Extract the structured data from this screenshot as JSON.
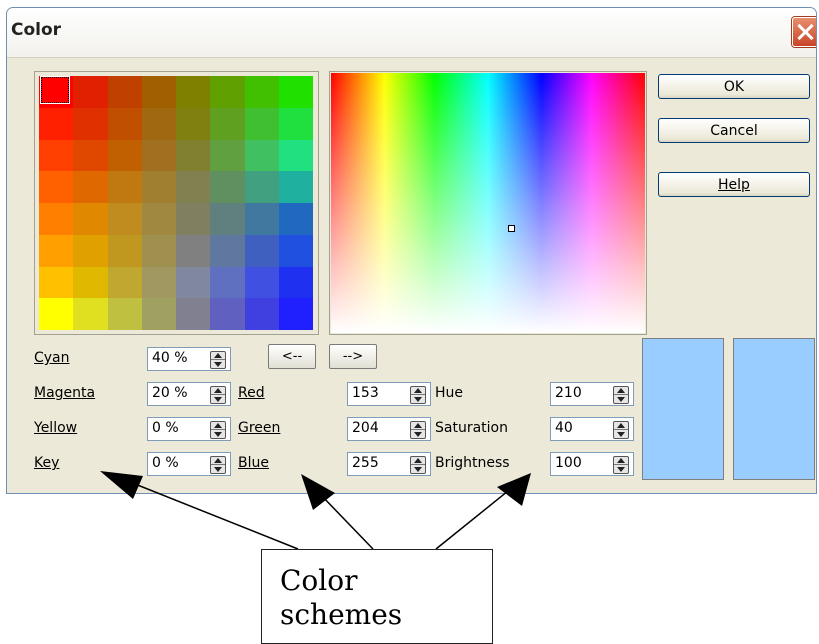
{
  "dialog": {
    "title": "Color",
    "buttons": {
      "ok": "OK",
      "cancel": "Cancel",
      "help": "Help"
    },
    "arrow_left": "<--",
    "arrow_right": "-->"
  },
  "palette": {
    "colors": [
      "#ff0000",
      "#e02000",
      "#c04000",
      "#a06000",
      "#808000",
      "#60a000",
      "#40c000",
      "#20e000",
      "#ff2000",
      "#e03000",
      "#c05000",
      "#a06810",
      "#808010",
      "#60a020",
      "#40c030",
      "#20e040",
      "#ff4000",
      "#e04800",
      "#c06000",
      "#a07020",
      "#808030",
      "#60a040",
      "#40c060",
      "#20e080",
      "#ff6000",
      "#e06800",
      "#c07810",
      "#a08030",
      "#808050",
      "#609060",
      "#40a080",
      "#20b0a0",
      "#ff8000",
      "#e08800",
      "#c08c20",
      "#a08840",
      "#808060",
      "#608080",
      "#4078a0",
      "#2068c0",
      "#ffa000",
      "#e0a000",
      "#c09820",
      "#a09050",
      "#808080",
      "#6078a0",
      "#4060c0",
      "#2050e0",
      "#ffc000",
      "#e0b800",
      "#c0a830",
      "#a09860",
      "#8088a0",
      "#6070c0",
      "#4050e0",
      "#2030f0",
      "#ffff00",
      "#e0e020",
      "#c0c040",
      "#a0a060",
      "#808090",
      "#6060c0",
      "#4040e0",
      "#2020ff"
    ]
  },
  "cmyk": {
    "cyan": {
      "label": "Cyan",
      "value": "40 %"
    },
    "magenta": {
      "label": "Magenta",
      "value": "20 %"
    },
    "yellow": {
      "label": "Yellow",
      "value": "0 %"
    },
    "key": {
      "label": "Key",
      "value": "0 %"
    }
  },
  "rgb": {
    "red": {
      "label": "Red",
      "value": "153"
    },
    "green": {
      "label": "Green",
      "value": "204"
    },
    "blue": {
      "label": "Blue",
      "value": "255"
    }
  },
  "hsb": {
    "hue": {
      "label": "Hue",
      "value": "210"
    },
    "saturation": {
      "label": "Saturation",
      "value": "40"
    },
    "brightness": {
      "label": "Brightness",
      "value": "100"
    }
  },
  "preview": {
    "current_color": "#99ccff",
    "new_color": "#99ccff"
  },
  "annotation": {
    "callout_line1": "Color",
    "callout_line2": "schemes"
  }
}
